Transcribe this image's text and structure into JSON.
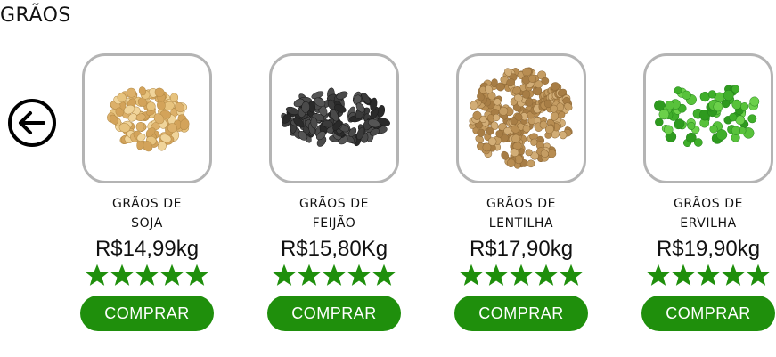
{
  "section": {
    "title": "GRÃOS"
  },
  "back_icon": "arrow-left-circle-icon",
  "colors": {
    "accent": "#1f8f0c",
    "star": "#1f8f0c",
    "border": "#b4b4b4"
  },
  "products": [
    {
      "name_line1": "GRÃOS DE",
      "name_line2": "SOJA",
      "price": "R$14,99kg",
      "rating": 5,
      "button": "COMPRAR",
      "image_icon": "soybeans-image"
    },
    {
      "name_line1": "GRÃOS DE",
      "name_line2": "FEIJÃO",
      "price": "R$15,80Kg",
      "rating": 5,
      "button": "COMPRAR",
      "image_icon": "black-beans-image"
    },
    {
      "name_line1": "GRÃOS DE",
      "name_line2": "LENTILHA",
      "price": "R$17,90kg",
      "rating": 5,
      "button": "COMPRAR",
      "image_icon": "lentils-image"
    },
    {
      "name_line1": "GRÃOS DE",
      "name_line2": "ERVILHA",
      "price": "R$19,90kg",
      "rating": 5,
      "button": "COMPRAR",
      "image_icon": "peas-image"
    }
  ]
}
